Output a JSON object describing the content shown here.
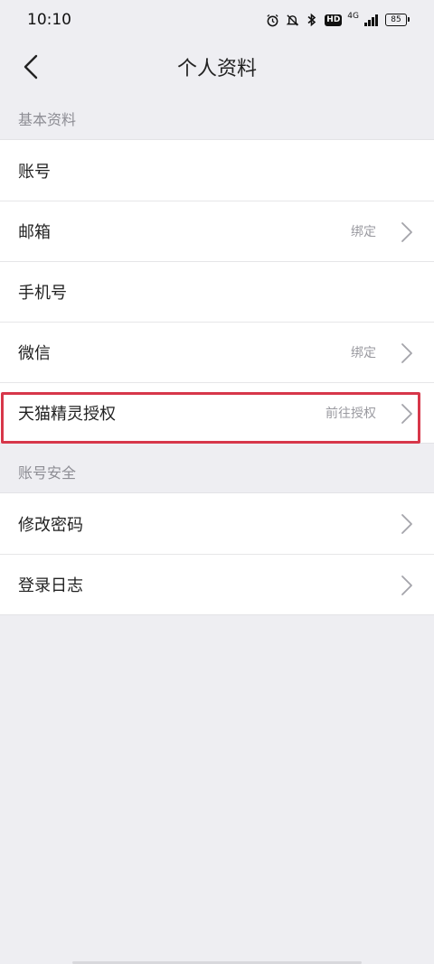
{
  "status_bar": {
    "time": "10:10",
    "network": "4G",
    "hd": "HD",
    "battery": "85",
    "icons": [
      "alarm-icon",
      "mute-icon",
      "bluetooth-icon",
      "hd-icon",
      "signal-icon",
      "battery-icon"
    ]
  },
  "header": {
    "title": "个人资料",
    "back_icon": "chevron-left-icon"
  },
  "sections": [
    {
      "title": "基本资料",
      "items": [
        {
          "label": "账号",
          "value": ""
        },
        {
          "label": "邮箱",
          "value": "绑定"
        },
        {
          "label": "手机号",
          "value": ""
        },
        {
          "label": "微信",
          "value": "绑定"
        },
        {
          "label": "天猫精灵授权",
          "value": "前往授权",
          "highlighted": true
        }
      ]
    },
    {
      "title": "账号安全",
      "items": [
        {
          "label": "修改密码",
          "value": ""
        },
        {
          "label": "登录日志",
          "value": ""
        }
      ]
    }
  ],
  "colors": {
    "background": "#eeeef2",
    "highlight_border": "#d7374a",
    "secondary_text": "#9a9aa0"
  }
}
